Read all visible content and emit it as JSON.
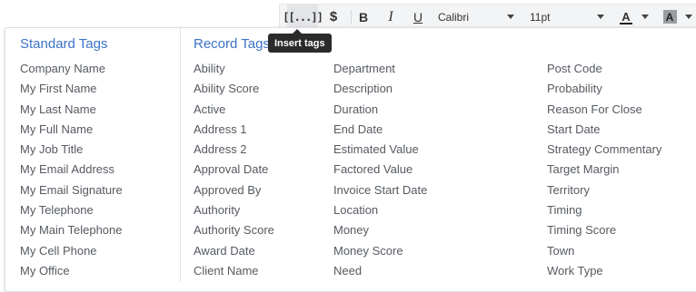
{
  "toolbar": {
    "insert_tags_label": "[[...]]",
    "currency_label": "$",
    "bold_label": "B",
    "italic_label": "I",
    "underline_label": "U",
    "font_value": "Calibri",
    "size_value": "11pt",
    "font_color_label": "A",
    "highlight_label": "A"
  },
  "tooltip": {
    "text": "Insert tags"
  },
  "panel": {
    "standard_title": "Standard Tags",
    "record_title": "Record Tags",
    "standard_tags": [
      "Company Name",
      "My First Name",
      "My Last Name",
      "My Full Name",
      "My Job Title",
      "My Email Address",
      "My Email Signature",
      "My Telephone",
      "My Main Telephone",
      "My Cell Phone",
      "My Office"
    ],
    "record_tags_col1": [
      "Ability",
      "Ability Score",
      "Active",
      "Address 1",
      "Address 2",
      "Approval Date",
      "Approved By",
      "Authority",
      "Authority Score",
      "Award Date",
      "Client Name"
    ],
    "record_tags_col2": [
      "Department",
      "Description",
      "Duration",
      "End Date",
      "Estimated Value",
      "Factored Value",
      "Invoice Start Date",
      "Location",
      "Money",
      "Money Score",
      "Need"
    ],
    "record_tags_col3": [
      "Post Code",
      "Probability",
      "Reason For Close",
      "Start Date",
      "Strategy Commentary",
      "Target Margin",
      "Territory",
      "Timing",
      "Timing Score",
      "Town",
      "Work Type"
    ]
  },
  "colors": {
    "accent": "#3a72c9",
    "text": "#555a60",
    "tooltip_bg": "#2b2b2b"
  }
}
